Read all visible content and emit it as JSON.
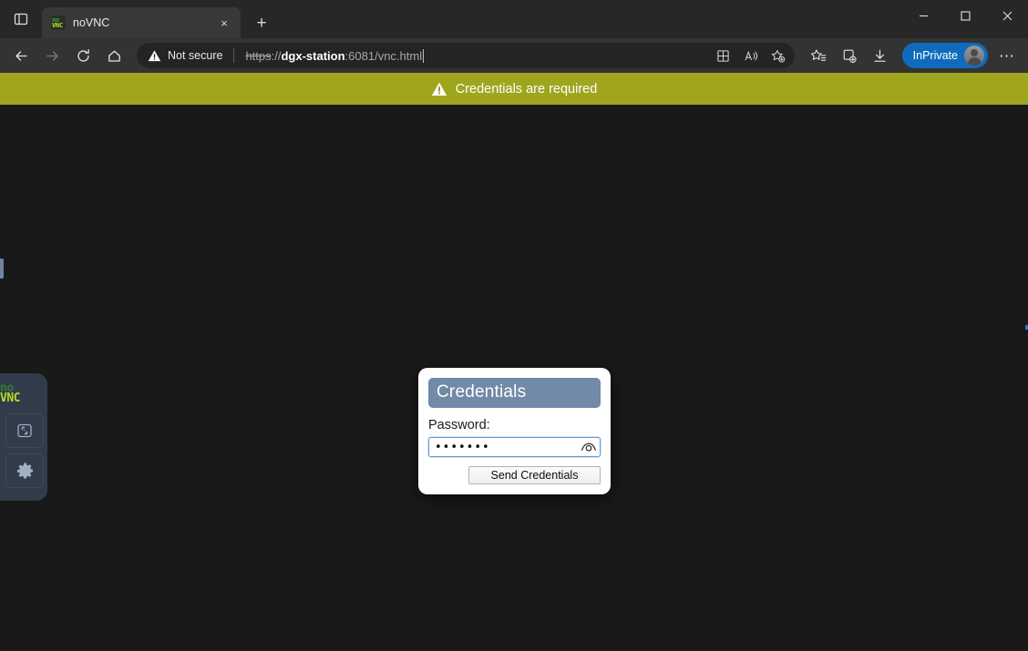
{
  "window": {
    "minimize_label": "Minimize",
    "maximize_label": "Maximize",
    "close_label": "Close"
  },
  "tabstrip": {
    "tab_search_icon": "tab-search-icon",
    "newtab_label": "+",
    "tabs": [
      {
        "title": "noVNC",
        "favicon_top": "no",
        "favicon_bottom": "VNC",
        "close_label": "×",
        "active": true
      }
    ]
  },
  "toolbar": {
    "back_label": "Back",
    "forward_label": "Forward",
    "refresh_label": "Refresh",
    "home_label": "Home",
    "security_text": "Not secure",
    "url": {
      "scheme": "https",
      "separator": "://",
      "host": "dgx-station",
      "rest": ":6081/vnc.html"
    },
    "split_screen_label": "Split screen",
    "read_aloud_label": "Read aloud",
    "add_favorite_label": "Add this page to favorites",
    "favorites_label": "Favorites",
    "collections_label": "Collections",
    "downloads_label": "Downloads",
    "inprivate_label": "InPrivate",
    "settings_label": "⋯"
  },
  "page": {
    "status_banner": {
      "text": "Credentials are required",
      "bg_color": "#a0a51e",
      "text_color": "#ffffff",
      "icon": "warning-triangle-icon"
    },
    "vnc_panel": {
      "logo_top": "no",
      "logo_bottom": "VNC",
      "buttons": [
        {
          "name": "fullscreen-button",
          "icon": "fullscreen-icon"
        },
        {
          "name": "settings-button",
          "icon": "gear-icon"
        }
      ]
    },
    "credentials_dialog": {
      "title": "Credentials",
      "title_bg": "#7289a8",
      "password_label": "Password:",
      "password_value": "•••••••",
      "password_placeholder": "",
      "reveal_icon": "eye-icon",
      "submit_label": "Send Credentials"
    }
  }
}
